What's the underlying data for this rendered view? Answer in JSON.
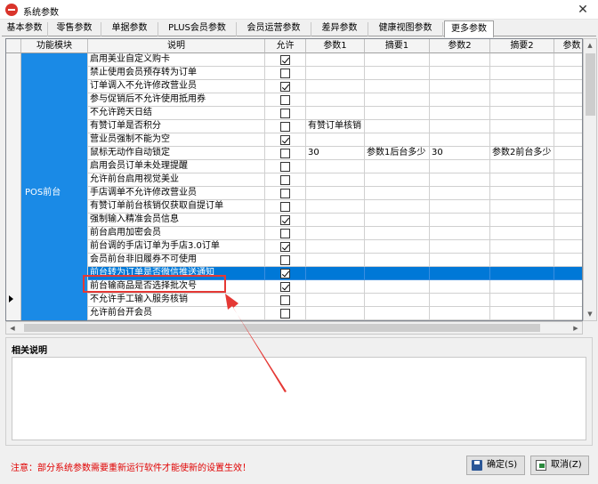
{
  "window": {
    "title": "系统参数",
    "close_glyph": "✕",
    "icon": "app-logo-icon"
  },
  "tabs": [
    {
      "label": "基本参数"
    },
    {
      "label": "零售参数"
    },
    {
      "label": "单据参数"
    },
    {
      "label": "PLUS会员参数"
    },
    {
      "label": "会员运营参数"
    },
    {
      "label": "差异参数"
    },
    {
      "label": "健康视图参数"
    },
    {
      "label": "更多参数",
      "active": true
    }
  ],
  "grid": {
    "columns": [
      "功能模块",
      "说明",
      "允许",
      "参数1",
      "摘要1",
      "参数2",
      "摘要2",
      "参数"
    ],
    "module": "POS前台",
    "rows": [
      {
        "desc": "启用美业自定义购卡",
        "allow": true,
        "p1": "",
        "s1": "",
        "p2": "",
        "s2": ""
      },
      {
        "desc": "禁止使用会员预存转为订单",
        "allow": false,
        "p1": "",
        "s1": "",
        "p2": "",
        "s2": ""
      },
      {
        "desc": "订单调入不允许修改营业员",
        "allow": true,
        "p1": "",
        "s1": "",
        "p2": "",
        "s2": ""
      },
      {
        "desc": "参与促销后不允许使用抵用券",
        "allow": false,
        "p1": "",
        "s1": "",
        "p2": "",
        "s2": ""
      },
      {
        "desc": "不允许跨天日结",
        "allow": false,
        "p1": "",
        "s1": "",
        "p2": "",
        "s2": ""
      },
      {
        "desc": "有赞订单是否积分",
        "allow": false,
        "p1": "有赞订单核销",
        "s1": "",
        "p2": "",
        "s2": ""
      },
      {
        "desc": "营业员强制不能为空",
        "allow": true,
        "p1": "",
        "s1": "",
        "p2": "",
        "s2": ""
      },
      {
        "desc": "鼠标无动作自动锁定",
        "allow": false,
        "p1": "30",
        "s1": "参数1后台多少",
        "p2": "30",
        "s2": "参数2前台多少"
      },
      {
        "desc": "启用会员订单未处理提醒",
        "allow": false,
        "p1": "",
        "s1": "",
        "p2": "",
        "s2": ""
      },
      {
        "desc": "允许前台启用视觉美业",
        "allow": false,
        "p1": "",
        "s1": "",
        "p2": "",
        "s2": ""
      },
      {
        "desc": "手店调单不允许修改营业员",
        "allow": false,
        "p1": "",
        "s1": "",
        "p2": "",
        "s2": ""
      },
      {
        "desc": "有赞订单前台核销仅获取自提订单",
        "allow": false,
        "p1": "",
        "s1": "",
        "p2": "",
        "s2": ""
      },
      {
        "desc": "强制输入精准会员信息",
        "allow": true,
        "p1": "",
        "s1": "",
        "p2": "",
        "s2": ""
      },
      {
        "desc": "前台启用加密会员",
        "allow": false,
        "p1": "",
        "s1": "",
        "p2": "",
        "s2": ""
      },
      {
        "desc": "前台调的手店订单为手店3.0订单",
        "allow": true,
        "p1": "",
        "s1": "",
        "p2": "",
        "s2": ""
      },
      {
        "desc": "会员前台非旧履券不可使用",
        "allow": false,
        "p1": "",
        "s1": "",
        "p2": "",
        "s2": ""
      },
      {
        "desc": "前台转为订单是否微信推送通知",
        "allow": true,
        "p1": "",
        "s1": "",
        "p2": "",
        "s2": "",
        "selected": true
      },
      {
        "desc": "前台输商品是否选择批次号",
        "allow": true,
        "p1": "",
        "s1": "",
        "p2": "",
        "s2": ""
      },
      {
        "desc": "不允许手工输入服务核销",
        "allow": false,
        "p1": "",
        "s1": "",
        "p2": "",
        "s2": ""
      },
      {
        "desc": "允许前台开会员",
        "allow": false,
        "p1": "",
        "s1": "",
        "p2": "",
        "s2": ""
      }
    ]
  },
  "related": {
    "title": "相关说明",
    "content": ""
  },
  "footer": {
    "notice": "注意：部分系统参数需要重新运行软件才能使新的设置生效！",
    "ok_label": "确定(S)",
    "cancel_label": "取消(Z)"
  },
  "colors": {
    "selection": "#0078d7",
    "module_bg": "#1a8ae6",
    "annotation": "#e53935",
    "notice": "#e00000"
  }
}
